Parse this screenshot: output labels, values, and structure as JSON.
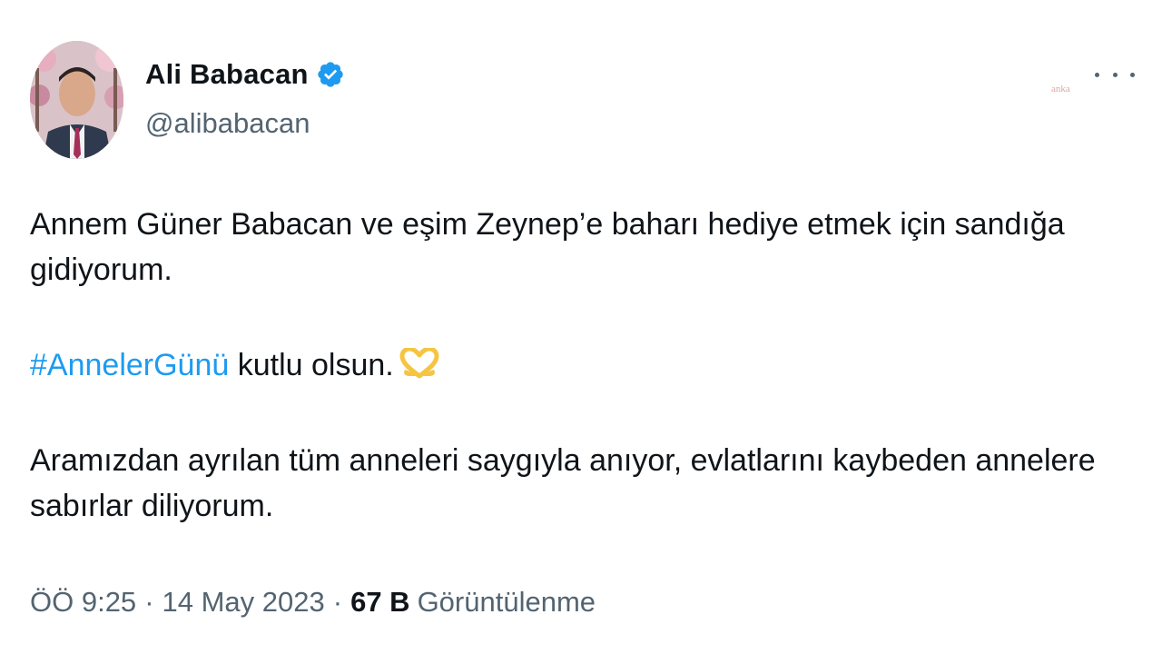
{
  "author": {
    "display_name": "Ali Babacan",
    "handle": "@alibabacan",
    "verified": true,
    "verified_color": "#1d9bf0"
  },
  "watermark": "anka",
  "tweet": {
    "paragraph_1": "Annem Güner Babacan ve eşim Zeynep’e baharı hediye etmek için sandığa gidiyorum.",
    "hashtag": "#AnnelerGünü",
    "paragraph_2_rest": " kutlu olsun.",
    "emoji_name": "heart-hands-icon",
    "paragraph_3": "Aramızdan ayrılan tüm anneleri saygıyla anıyor, evlatlarını kaybeden annelere sabırlar diliyorum."
  },
  "meta": {
    "time": "ÖÖ 9:25",
    "separator": "·",
    "date": "14 May 2023",
    "views_count": "67 B",
    "views_label": "Görüntülenme"
  },
  "colors": {
    "link": "#1d9bf0",
    "secondary_text": "#536471",
    "primary_text": "#0f1419"
  }
}
